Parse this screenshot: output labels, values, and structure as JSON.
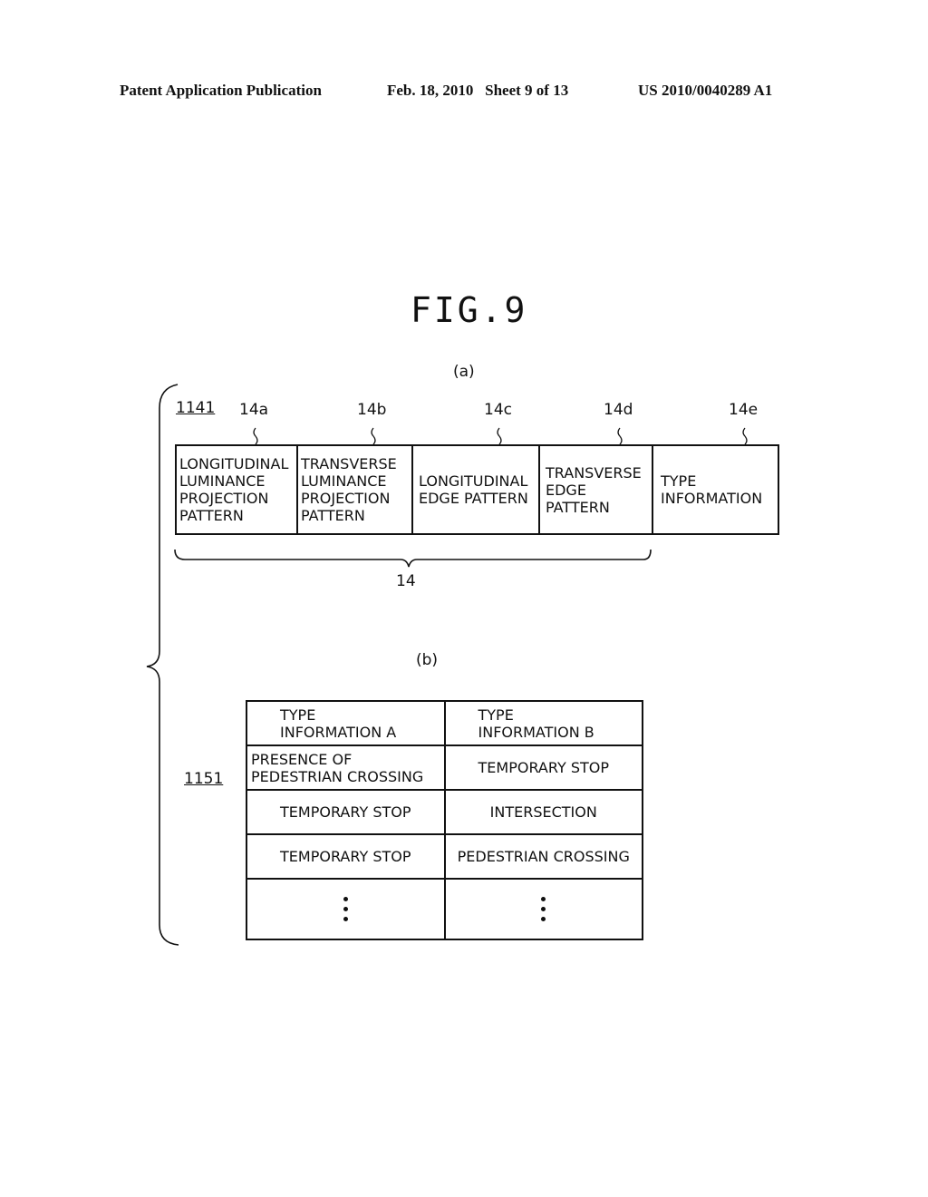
{
  "header": {
    "publication": "Patent Application Publication",
    "date_sheet": "Feb. 18, 2010   Sheet 9 of 13",
    "patent_number": "US 2010/0040289 A1"
  },
  "figure": {
    "title": "FIG.9",
    "part_a": {
      "label": "(a)",
      "record_ref": "1141",
      "group_ref": "14",
      "fields": [
        {
          "ref": "14a",
          "text": "LONGITUDINAL\nLUMINANCE\nPROJECTION\nPATTERN"
        },
        {
          "ref": "14b",
          "text": "TRANSVERSE\nLUMINANCE\nPROJECTION\nPATTERN"
        },
        {
          "ref": "14c",
          "text": "LONGITUDINAL\nEDGE PATTERN"
        },
        {
          "ref": "14d",
          "text": "TRANSVERSE\nEDGE\nPATTERN"
        },
        {
          "ref": "14e",
          "text": "TYPE\nINFORMATION"
        }
      ]
    },
    "part_b": {
      "label": "(b)",
      "table_ref": "1151",
      "headers": [
        "TYPE\nINFORMATION A",
        "TYPE\nINFORMATION B"
      ],
      "rows": [
        [
          "PRESENCE OF\nPEDESTRIAN CROSSING",
          "TEMPORARY STOP"
        ],
        [
          "TEMPORARY STOP",
          "INTERSECTION"
        ],
        [
          "TEMPORARY STOP",
          "PEDESTRIAN CROSSING"
        ]
      ],
      "continuation": "vertical-ellipsis"
    }
  }
}
